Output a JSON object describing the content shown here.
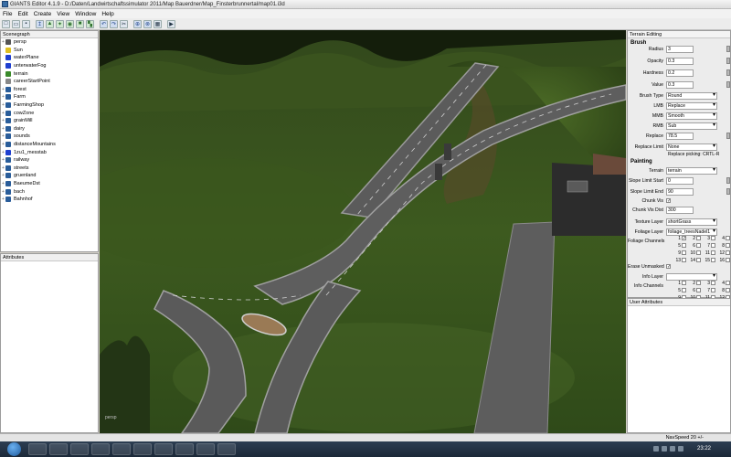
{
  "window": {
    "title": "GIANTS Editor 4.1.9 - D:/Daten/Landwirtschaftssimulator 2011/Map Bauerdner/Map_Finsterbrunnertal/map01.i3d"
  },
  "menu": [
    "File",
    "Edit",
    "Create",
    "View",
    "Window",
    "Help"
  ],
  "scenegraph": {
    "title": "Scenegraph",
    "items": [
      {
        "label": "persp",
        "icon": "camera-icon",
        "color": "#555555",
        "expand": "+"
      },
      {
        "label": "Sun",
        "icon": "light-icon",
        "color": "#e0c020",
        "expand": ""
      },
      {
        "label": "waterPlane",
        "icon": "shape-icon",
        "color": "#1f3fd0",
        "expand": ""
      },
      {
        "label": "unterwaterFog",
        "icon": "shape-icon",
        "color": "#1f3fd0",
        "expand": ""
      },
      {
        "label": "terrain",
        "icon": "terrain-icon",
        "color": "#3a8a2a",
        "expand": ""
      },
      {
        "label": "careerStartPoint",
        "icon": "transform-icon",
        "color": "#888888",
        "expand": ""
      },
      {
        "label": "forest",
        "icon": "group-icon",
        "color": "#2a5d9a",
        "expand": "+"
      },
      {
        "label": "Farm",
        "icon": "group-icon",
        "color": "#2a5d9a",
        "expand": "+"
      },
      {
        "label": "FarmingShop",
        "icon": "group-icon",
        "color": "#2a5d9a",
        "expand": "+"
      },
      {
        "label": "cowZone",
        "icon": "group-icon",
        "color": "#2a5d9a",
        "expand": "+"
      },
      {
        "label": "grainMill",
        "icon": "group-icon",
        "color": "#2a5d9a",
        "expand": "+"
      },
      {
        "label": "dairy",
        "icon": "group-icon",
        "color": "#2a5d9a",
        "expand": "+"
      },
      {
        "label": "sounds",
        "icon": "group-icon",
        "color": "#2a5d9a",
        "expand": "+"
      },
      {
        "label": "distanceMountains",
        "icon": "group-icon",
        "color": "#2a5d9a",
        "expand": "+"
      },
      {
        "label": "1zu1_messtab",
        "icon": "shape-icon",
        "color": "#1f3fd0",
        "expand": "+"
      },
      {
        "label": "railway",
        "icon": "group-icon",
        "color": "#2a5d9a",
        "expand": "+"
      },
      {
        "label": "streets",
        "icon": "group-icon",
        "color": "#2a5d9a",
        "expand": "+"
      },
      {
        "label": "gruenland",
        "icon": "group-icon",
        "color": "#2a5d9a",
        "expand": "+"
      },
      {
        "label": "BaeumeDst",
        "icon": "group-icon",
        "color": "#2a5d9a",
        "expand": "+"
      },
      {
        "label": "bach",
        "icon": "group-icon",
        "color": "#2a5d9a",
        "expand": "+"
      },
      {
        "label": "Bahnhof",
        "icon": "group-icon",
        "color": "#2a5d9a",
        "expand": "+"
      }
    ]
  },
  "attributes": {
    "title": "Attributes"
  },
  "viewport": {
    "camera_label": "persp"
  },
  "terrain_editing": {
    "title": "Terrain Editing",
    "brush_section": "Brush",
    "radius": {
      "label": "Radius",
      "value": "3"
    },
    "opacity": {
      "label": "Opacity",
      "value": "0.3"
    },
    "hardness": {
      "label": "Hardness",
      "value": "0.2"
    },
    "value": {
      "label": "Value",
      "value": "0.3"
    },
    "brush_type": {
      "label": "Brush Type",
      "value": "Round"
    },
    "lmb": {
      "label": "LMB",
      "value": "Replace"
    },
    "mmb": {
      "label": "MMB",
      "value": "Smooth"
    },
    "rmb": {
      "label": "RMB",
      "value": "Sub"
    },
    "replace": {
      "label": "Replace",
      "value": "78.5"
    },
    "replace_limit": {
      "label": "Replace Limit",
      "value": "None"
    },
    "replace_picking": "Replace picking: CRTL-R",
    "painting_section": "Painting",
    "terrain": {
      "label": "Terrain",
      "value": "terrain"
    },
    "slope_start": {
      "label": "Slope Limit Start",
      "value": "0"
    },
    "slope_end": {
      "label": "Slope Limit End",
      "value": "90"
    },
    "chunk_vis": {
      "label": "Chunk Vis"
    },
    "chunk_vis_dist": {
      "label": "Chunk Vis Dist",
      "value": "300"
    },
    "texture_layer": {
      "label": "Texture Layer",
      "value": "shortGrass"
    },
    "foliage_layer": {
      "label": "Foliage Layer",
      "value": "foliage_treesNadel1"
    },
    "foliage_channels": {
      "label": "Foliage Channels",
      "numbers": [
        "1",
        "2",
        "3",
        "4",
        "5",
        "6",
        "7",
        "8",
        "9",
        "10",
        "11",
        "12",
        "13",
        "14",
        "15",
        "16"
      ],
      "checked": [
        1
      ]
    },
    "erase_unmasked": {
      "label": "Erase Unmasked"
    },
    "info_layer": {
      "label": "Info Layer",
      "value": ""
    },
    "info_channels": {
      "label": "Info Channels",
      "numbers": [
        "1",
        "2",
        "3",
        "4",
        "5",
        "6",
        "7",
        "8",
        "9",
        "10",
        "11",
        "12"
      ],
      "checked": []
    }
  },
  "user_attributes": {
    "title": "User Attributes"
  },
  "status": {
    "nav_speed": "NavSpeed 20 +/-"
  },
  "taskbar": {
    "clock": "23:22"
  }
}
